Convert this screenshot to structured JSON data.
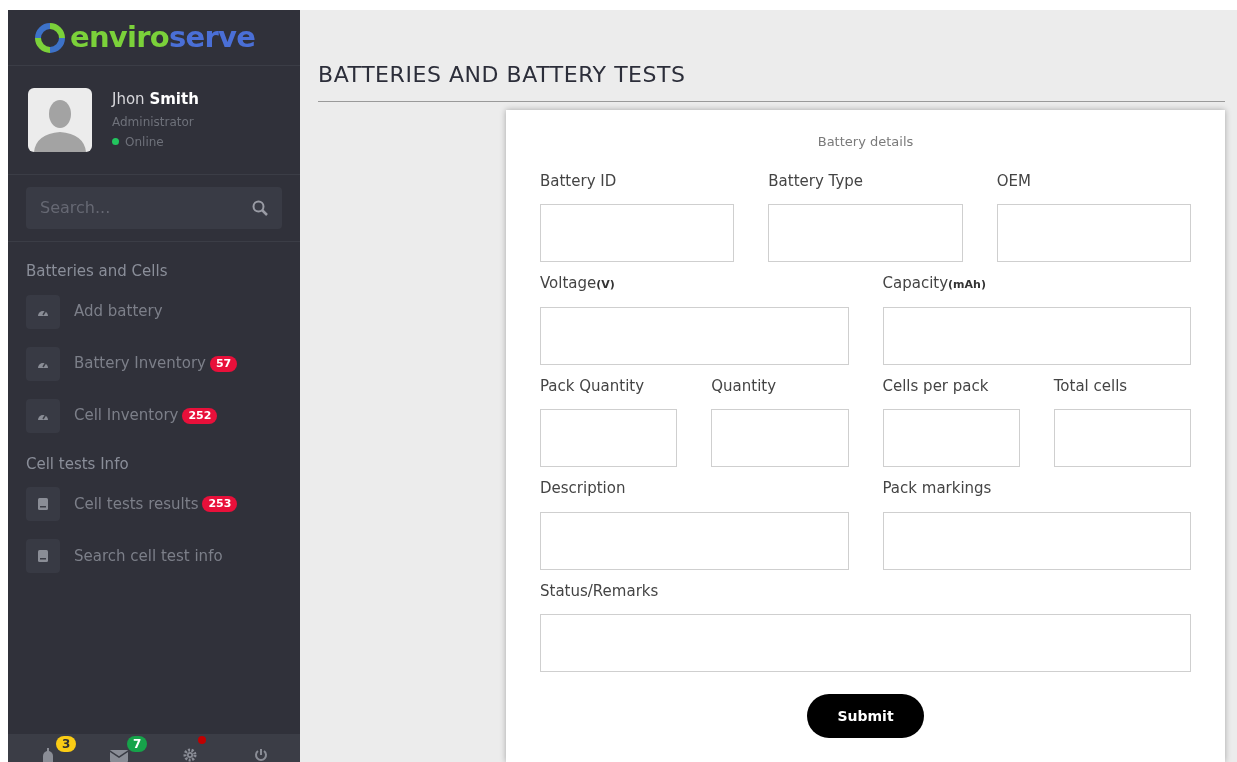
{
  "sidebar": {
    "logo": {
      "part_1": "enviro",
      "part_2": "serve"
    },
    "user": {
      "first_name": "Jhon",
      "last_name": "Smith",
      "role": "Administrator",
      "status": "Online",
      "color": "#22c55e"
    },
    "search": {
      "placeholder": "Search..."
    },
    "sections": [
      {
        "title": "Batteries and Cells",
        "items": [
          {
            "label": "Add battery",
            "kind": "gauge"
          },
          {
            "label": "Battery Inventory",
            "kind": "gauge",
            "badge": "57"
          },
          {
            "label": "Cell Inventory",
            "kind": "gauge",
            "badge": "252"
          }
        ]
      },
      {
        "title": "Cell tests Info",
        "items": [
          {
            "label": "Cell tests results",
            "kind": "book",
            "badge": "253"
          },
          {
            "label": "Search cell test info",
            "kind": "book"
          }
        ]
      }
    ],
    "footer": [
      {
        "kind": "bell",
        "badge": "3",
        "color": "#facc15"
      },
      {
        "kind": "mail",
        "badge": "7",
        "color": "#16a34a"
      },
      {
        "kind": "gear",
        "color": "#c00000"
      },
      {
        "kind": "power"
      }
    ]
  },
  "page": {
    "title": "BATTERIES AND BATTERY TESTS"
  },
  "form": {
    "title": "Battery details",
    "rows": [
      [
        {
          "label": "Battery ID"
        },
        {
          "label": "Battery Type"
        },
        {
          "label": "OEM"
        }
      ],
      [
        {
          "label": "Voltage",
          "unit": "(V)"
        },
        {
          "label": "Capacity",
          "unit": "(mAh)"
        }
      ],
      [
        {
          "fields": [
            {
              "label": "Pack Quantity"
            },
            {
              "label": "Quantity"
            }
          ]
        },
        {
          "fields": [
            {
              "label": "Cells per pack"
            },
            {
              "label": "Total cells"
            }
          ]
        }
      ],
      [
        {
          "label": "Description"
        },
        {
          "label": "Pack markings"
        }
      ],
      [
        {
          "label": "Status/Remarks"
        }
      ]
    ],
    "submit": "Submit"
  }
}
